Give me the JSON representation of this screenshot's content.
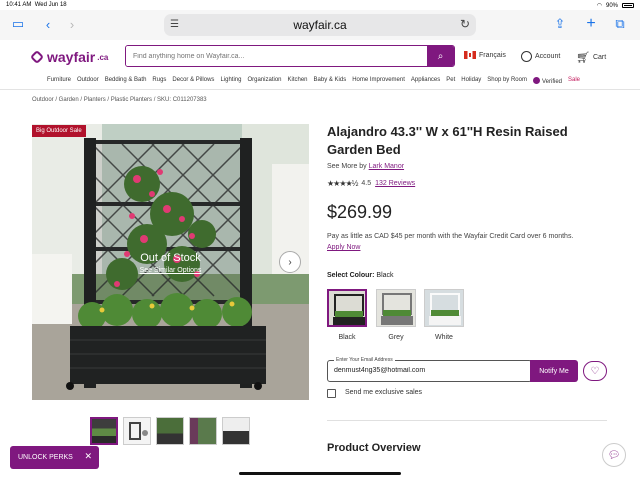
{
  "status": {
    "time": "10:41 AM",
    "date": "Wed Jun 18",
    "battery": "90%"
  },
  "browser": {
    "url": "wayfair.ca"
  },
  "header": {
    "logo": "wayfair",
    "logo_suffix": ".ca",
    "search_placeholder": "Find anything home on Wayfair.ca...",
    "lang": "Français",
    "account": "Account",
    "cart": "Cart"
  },
  "nav": {
    "items": [
      "Furniture",
      "Outdoor",
      "Bedding & Bath",
      "Rugs",
      "Decor & Pillows",
      "Lighting",
      "Organization",
      "Kitchen",
      "Baby & Kids",
      "Home Improvement",
      "Appliances",
      "Pet",
      "Holiday",
      "Shop by Room"
    ],
    "verified": "Verified",
    "sale": "Sale"
  },
  "breadcrumb": "Outdoor / Garden / Planters / Plastic Planters / SKU: C011207383",
  "gallery": {
    "badge": "Big Outdoor Sale",
    "out_of_stock": "Out of Stock",
    "see_similar": "See Similar Options"
  },
  "product": {
    "title": "Alajandro 43.3'' W x 61''H Resin Raised Garden Bed",
    "see_more_prefix": "See More by",
    "brand": "Lark Manor",
    "rating": "4.5",
    "reviews": "132 Reviews",
    "price": "$269.99",
    "finance_text": "Pay as little as CAD $45 per month with the Wayfair Credit Card over 6 months.",
    "apply_now": "Apply Now",
    "colour_label": "Select Colour:",
    "colour_selected": "Black",
    "colours": [
      "Black",
      "Grey",
      "White"
    ]
  },
  "notify": {
    "label": "Enter Your Email Address",
    "email": "denmust4ng35@hotmail.com",
    "button": "Notify Me",
    "exclusive": "Send me exclusive sales"
  },
  "overview_heading": "Product Overview",
  "promo": {
    "unlock": "UNLOCK PERKS"
  }
}
